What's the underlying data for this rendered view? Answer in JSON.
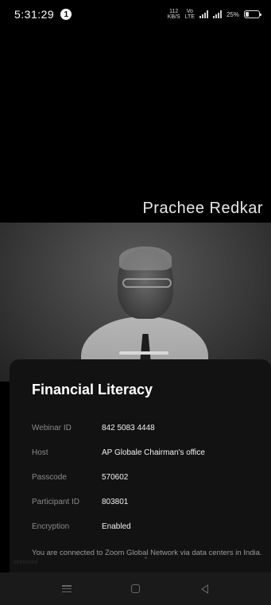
{
  "status_bar": {
    "time": "5:31:29",
    "notification_count": "1",
    "net_speed_value": "112",
    "net_speed_unit": "KB/S",
    "volte_top": "Vo",
    "volte_bottom": "LTE",
    "battery_percent": "25%",
    "battery_level": 0.25
  },
  "top_tile": {
    "speaker_name": "Prachee Redkar"
  },
  "meeting": {
    "title": "Financial Literacy",
    "details": [
      {
        "label": "Webinar ID",
        "value": "842 5083 4448"
      },
      {
        "label": "Host",
        "value": "AP Globale Chairman's office"
      },
      {
        "label": "Passcode",
        "value": "570602"
      },
      {
        "label": "Participant ID",
        "value": "803801"
      },
      {
        "label": "Encryption",
        "value": "Enabled"
      }
    ],
    "network_note": "You are connected to Zoom Global Network via data centers in India."
  },
  "faint_label": "Seasoned",
  "nav": {
    "menu_icon": "menu-icon",
    "home_icon": "home-square-icon",
    "back_icon": "back-triangle-icon"
  }
}
